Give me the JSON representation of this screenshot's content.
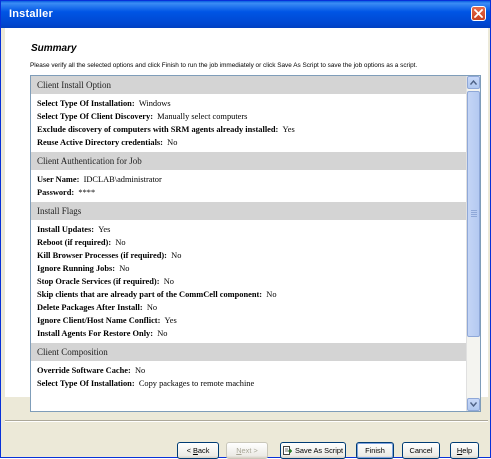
{
  "window": {
    "title": "Installer"
  },
  "summary": {
    "heading": "Summary",
    "instruction": "Please verify all the selected options and click Finish to run the job immediately or click Save As Script to save the job options as a script."
  },
  "sections": [
    {
      "header": "Client Install Option",
      "rows": [
        {
          "key": "Select Type Of Installation:",
          "value": "Windows"
        },
        {
          "key": "Select Type Of Client Discovery:",
          "value": "Manually select computers"
        },
        {
          "key": "Exclude discovery of computers with SRM agents already installed:",
          "value": "Yes"
        },
        {
          "key": "Reuse Active Directory credentials:",
          "value": "No"
        }
      ]
    },
    {
      "header": "Client Authentication for Job",
      "rows": [
        {
          "key": "User Name:",
          "value": "IDCLAB\\administrator"
        },
        {
          "key": "Password:",
          "value": "****"
        }
      ]
    },
    {
      "header": "Install Flags",
      "rows": [
        {
          "key": "Install Updates:",
          "value": "Yes"
        },
        {
          "key": "Reboot (if required):",
          "value": "No"
        },
        {
          "key": "Kill Browser Processes (if required):",
          "value": "No"
        },
        {
          "key": "Ignore Running Jobs:",
          "value": "No"
        },
        {
          "key": "Stop Oracle Services (if required):",
          "value": "No"
        },
        {
          "key": "Skip clients that are already part of the CommCell component:",
          "value": "No"
        },
        {
          "key": "Delete Packages After Install:",
          "value": "No"
        },
        {
          "key": "Ignore Client/Host Name Conflict:",
          "value": "Yes"
        },
        {
          "key": "Install Agents For Restore Only:",
          "value": "No"
        }
      ]
    },
    {
      "header": "Client Composition",
      "rows": [
        {
          "key": "Override Software Cache:",
          "value": "No"
        },
        {
          "key": "Select Type Of Installation:",
          "value": "Copy packages to remote machine"
        }
      ]
    }
  ],
  "buttons": {
    "back_prefix": "< ",
    "back_hotkey": "B",
    "back_rest": "ack",
    "next_hotkey": "N",
    "next_rest": "ext >",
    "save_as_script": "Save As Script",
    "finish": "Finish",
    "cancel": "Cancel",
    "help_hotkey": "H",
    "help_rest": "elp"
  }
}
